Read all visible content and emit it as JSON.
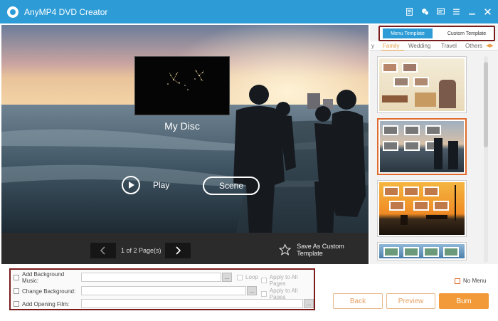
{
  "app": {
    "title": "AnyMP4 DVD Creator"
  },
  "titlebar_icons": [
    "document-icon",
    "chat-icon",
    "feedback-icon",
    "menu-icon",
    "minimize-icon",
    "close-icon"
  ],
  "preview": {
    "disc_title": "My Disc",
    "play_label": "Play",
    "scene_label": "Scene",
    "page_text": "1 of 2 Page(s)",
    "save_template_label": "Save As Custom Template"
  },
  "template_panel": {
    "tabs": [
      "Menu Template",
      "Custom Template"
    ],
    "active_tab": "Menu Template",
    "categories": [
      "y",
      "Family",
      "Wedding",
      "Travel",
      "Others"
    ],
    "active_category": "Family",
    "selected_template_index": 1
  },
  "options": {
    "background_music_label": "Add Background Music:",
    "change_background_label": "Change Background:",
    "opening_film_label": "Add Opening Film:",
    "loop_label": "Loop",
    "apply_all_label": "Apply to All Pages",
    "browse_label": "..."
  },
  "no_menu_label": "No Menu",
  "buttons": {
    "back": "Back",
    "preview": "Preview",
    "burn": "Burn"
  },
  "colors": {
    "titlebar": "#2c9bd6",
    "accent_orange": "#f29a39",
    "highlight_box": "#7a1c1c",
    "selected_template": "#e06b2e"
  }
}
